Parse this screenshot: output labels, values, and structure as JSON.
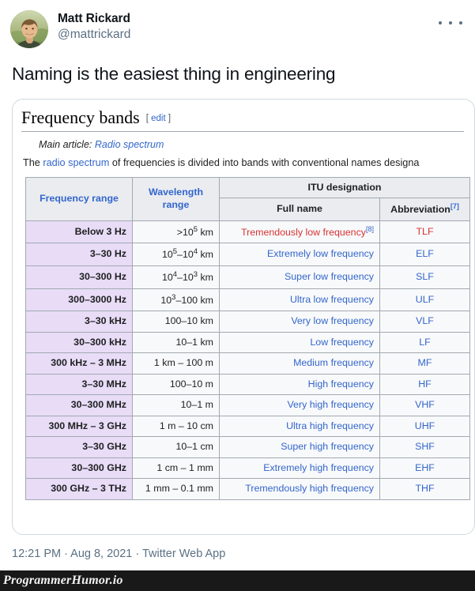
{
  "tweet": {
    "display_name": "Matt Rickard",
    "handle": "@mattrickard",
    "more_icon": "more-horizontal-icon",
    "text": "Naming is the easiest thing in engineering",
    "footer": "12:21 PM · Aug 8, 2021 · Twitter Web App"
  },
  "wiki": {
    "heading": "Frequency bands",
    "edit_open": "[",
    "edit_label": "edit",
    "edit_close": "]",
    "main_article_prefix": "Main article: ",
    "main_article_link": "Radio spectrum",
    "para_before": "The ",
    "para_link": "radio spectrum",
    "para_after": " of frequencies is divided into bands with conventional names designa",
    "table": {
      "headers": {
        "frequency_range": "Frequency range",
        "wavelength_range": "Wavelength range",
        "itu_designation": "ITU designation",
        "full_name": "Full name",
        "abbreviation": "Abbreviation",
        "abbreviation_ref": "[7]"
      },
      "rows": [
        {
          "frequency": "Below 3 Hz",
          "wavelength_html": ">10<sup class=\"exp\">5</sup> km",
          "full_name": "Tremendously low frequency",
          "full_name_ref": "[8]",
          "full_name_color": "red",
          "abbr": "TLF",
          "abbr_color": "red"
        },
        {
          "frequency": "3–30 Hz",
          "wavelength_html": "10<sup class=\"exp\">5</sup>–10<sup class=\"exp\">4</sup> km",
          "full_name": "Extremely low frequency",
          "full_name_ref": "",
          "full_name_color": "blue",
          "abbr": "ELF",
          "abbr_color": "blue"
        },
        {
          "frequency": "30–300 Hz",
          "wavelength_html": "10<sup class=\"exp\">4</sup>–10<sup class=\"exp\">3</sup> km",
          "full_name": "Super low frequency",
          "full_name_ref": "",
          "full_name_color": "blue",
          "abbr": "SLF",
          "abbr_color": "blue"
        },
        {
          "frequency": "300–3000 Hz",
          "wavelength_html": "10<sup class=\"exp\">3</sup>–100 km",
          "full_name": "Ultra low frequency",
          "full_name_ref": "",
          "full_name_color": "blue",
          "abbr": "ULF",
          "abbr_color": "blue"
        },
        {
          "frequency": "3–30 kHz",
          "wavelength_html": "100–10 km",
          "full_name": "Very low frequency",
          "full_name_ref": "",
          "full_name_color": "blue",
          "abbr": "VLF",
          "abbr_color": "blue"
        },
        {
          "frequency": "30–300 kHz",
          "wavelength_html": "10–1 km",
          "full_name": "Low frequency",
          "full_name_ref": "",
          "full_name_color": "blue",
          "abbr": "LF",
          "abbr_color": "blue"
        },
        {
          "frequency": "300 kHz – 3 MHz",
          "wavelength_html": "1 km – 100 m",
          "full_name": "Medium frequency",
          "full_name_ref": "",
          "full_name_color": "blue",
          "abbr": "MF",
          "abbr_color": "blue"
        },
        {
          "frequency": "3–30 MHz",
          "wavelength_html": "100–10 m",
          "full_name": "High frequency",
          "full_name_ref": "",
          "full_name_color": "blue",
          "abbr": "HF",
          "abbr_color": "blue"
        },
        {
          "frequency": "30–300 MHz",
          "wavelength_html": "10–1 m",
          "full_name": "Very high frequency",
          "full_name_ref": "",
          "full_name_color": "blue",
          "abbr": "VHF",
          "abbr_color": "blue"
        },
        {
          "frequency": "300 MHz – 3 GHz",
          "wavelength_html": "1 m – 10 cm",
          "full_name": "Ultra high frequency",
          "full_name_ref": "",
          "full_name_color": "blue",
          "abbr": "UHF",
          "abbr_color": "blue"
        },
        {
          "frequency": "3–30 GHz",
          "wavelength_html": "10–1 cm",
          "full_name": "Super high frequency",
          "full_name_ref": "",
          "full_name_color": "blue",
          "abbr": "SHF",
          "abbr_color": "blue"
        },
        {
          "frequency": "30–300 GHz",
          "wavelength_html": "1 cm – 1 mm",
          "full_name": "Extremely high frequency",
          "full_name_ref": "",
          "full_name_color": "blue",
          "abbr": "EHF",
          "abbr_color": "blue"
        },
        {
          "frequency": "300 GHz – 3 THz",
          "wavelength_html": "1 mm – 0.1 mm",
          "full_name": "Tremendously high frequency",
          "full_name_ref": "",
          "full_name_color": "blue",
          "abbr": "THF",
          "abbr_color": "blue"
        }
      ]
    }
  },
  "watermark": {
    "label": "ProgrammerHumor.io"
  },
  "colors": {
    "link_blue": "#3366cc",
    "link_red": "#d73333",
    "freq_cell_bg": "#e8dcf7",
    "table_header_bg": "#eaecf0",
    "table_cell_bg": "#f8f9fa",
    "table_border": "#a2a9b1",
    "card_border": "#cfd9de",
    "muted_text": "#5b7083",
    "primary_text": "#0f1419"
  }
}
